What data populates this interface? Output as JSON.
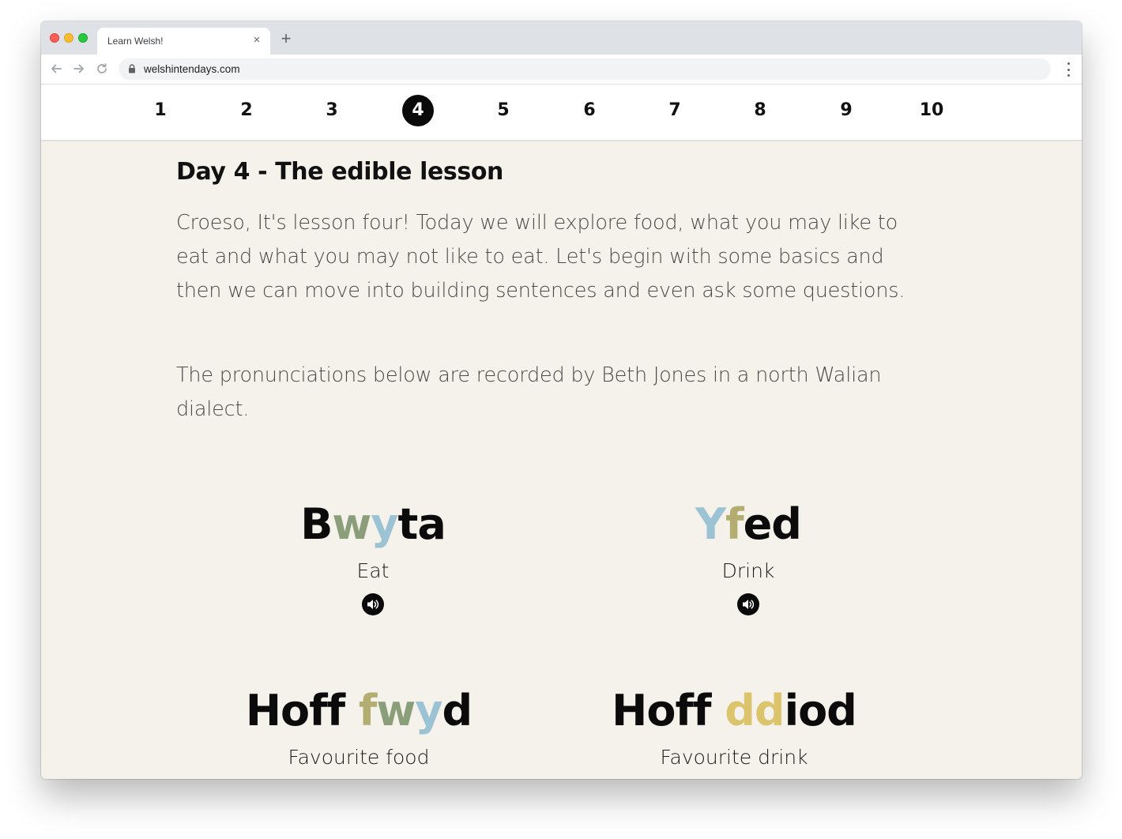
{
  "browser": {
    "tab_title": "Learn Welsh!",
    "tab_close": "×",
    "new_tab": "+",
    "url": "welshintendays.com"
  },
  "day_nav": {
    "days": [
      "1",
      "2",
      "3",
      "4",
      "5",
      "6",
      "7",
      "8",
      "9",
      "10"
    ],
    "active_day": "4"
  },
  "lesson": {
    "title": "Day 4 - The edible lesson",
    "intro": "Croeso, It's lesson four! Today we will explore food, what you may like to eat and what you may not like to eat. Let's begin with some basics and then we can move into building sentences and even ask some questions.",
    "note": "The pronunciations below are recorded by Beth Jones in a north Walian dialect."
  },
  "words": [
    {
      "welsh_parts": [
        "B",
        "w",
        "y",
        "ta"
      ],
      "english": "Eat",
      "has_audio": true
    },
    {
      "welsh_parts": [
        "Y",
        "f",
        "ed"
      ],
      "english": "Drink",
      "has_audio": true
    },
    {
      "welsh_parts": [
        "Hoff ",
        "f",
        "w",
        "y",
        "d"
      ],
      "english": "Favourite food",
      "has_audio": false
    },
    {
      "welsh_parts": [
        "Hoff ",
        "d",
        "d",
        "iod"
      ],
      "english": "Favourite drink",
      "has_audio": false
    }
  ],
  "colors": {
    "letter_dark": "#0b0b0b",
    "letter_sage": "#8a9e7a",
    "letter_blue": "#9cc3d3",
    "letter_olive": "#b4ad72",
    "letter_gold": "#dcc46c",
    "page_background": "#f5f2ec",
    "active_day": "#0a0a0a"
  },
  "icons": {
    "audio": "speaker-icon",
    "lock": "lock-icon",
    "back": "arrow-left-icon",
    "forward": "arrow-right-icon",
    "reload": "reload-icon",
    "menu": "kebab-menu-icon"
  }
}
